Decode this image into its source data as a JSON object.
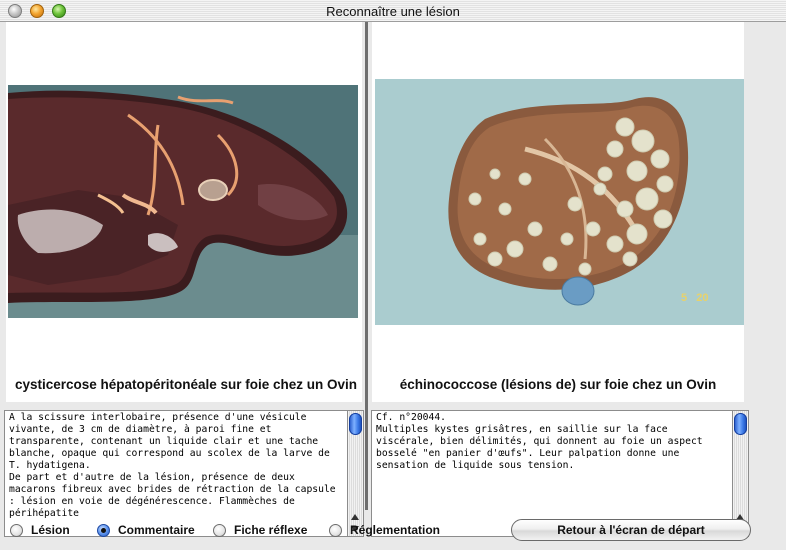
{
  "window": {
    "title": "Reconnaître une lésion"
  },
  "left": {
    "caption": "cysticercose hépatopéritonéale sur foie chez un Ovin",
    "comment": "A la scissure interlobaire, présence d'une vésicule vivante, de 3 cm de diamètre, à paroi fine et transparente, contenant un liquide clair et une tache blanche, opaque qui correspond au scolex de la larve de T. hydatigena.\nDe part et d'autre de la lésion, présence de deux macarons fibreux avec brides de rétraction de la capsule : lésion en voie de dégénérescence. Flammèches de périhépatite"
  },
  "right": {
    "caption": "échinococcose (lésions de) sur foie chez un Ovin",
    "comment": "Cf. n°20044.\nMultiples kystes grisâtres, en saillie sur la face viscérale, bien délimités, qui donnent au foie un aspect bosselé \"en panier d'œufs\". Leur palpation donne une sensation de liquide sous tension.",
    "photo_stamp": "5   20"
  },
  "bottom": {
    "radios": [
      {
        "label": "Lésion",
        "checked": false
      },
      {
        "label": "Commentaire",
        "checked": true
      },
      {
        "label": "Fiche réflexe",
        "checked": false
      },
      {
        "label": "Réglementation",
        "checked": false
      }
    ],
    "return_button": "Retour à l'écran de départ"
  }
}
